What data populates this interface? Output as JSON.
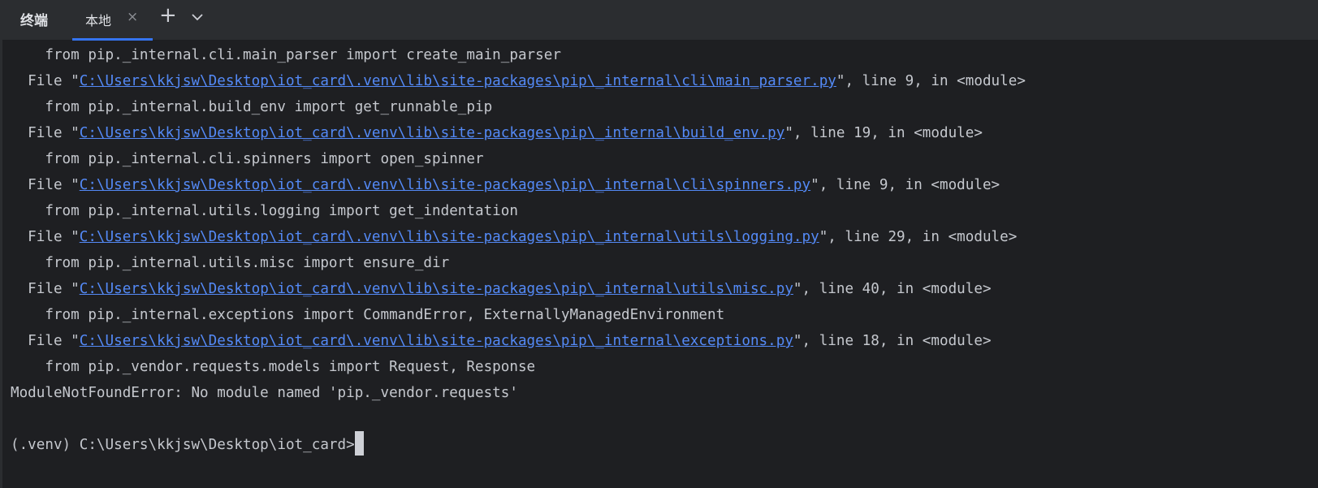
{
  "toolwindow": {
    "title": "终端",
    "tabs": [
      {
        "label": "本地",
        "close": "×"
      }
    ],
    "add_tab": "+",
    "colors": {
      "background": "#1e1f22",
      "header": "#2b2d30",
      "accent": "#3574f0",
      "link": "#548af7",
      "text": "#c5c8ce"
    }
  },
  "terminal": {
    "lines": [
      {
        "pre": "    from pip._internal.cli.main_parser import create_main_parser",
        "link": "",
        "post": ""
      },
      {
        "pre": "  File \"",
        "link": "C:\\Users\\kkjsw\\Desktop\\iot_card\\.venv\\lib\\site-packages\\pip\\_internal\\cli\\main_parser.py",
        "post": "\", line 9, in <module>"
      },
      {
        "pre": "    from pip._internal.build_env import get_runnable_pip",
        "link": "",
        "post": ""
      },
      {
        "pre": "  File \"",
        "link": "C:\\Users\\kkjsw\\Desktop\\iot_card\\.venv\\lib\\site-packages\\pip\\_internal\\build_env.py",
        "post": "\", line 19, in <module>"
      },
      {
        "pre": "    from pip._internal.cli.spinners import open_spinner",
        "link": "",
        "post": ""
      },
      {
        "pre": "  File \"",
        "link": "C:\\Users\\kkjsw\\Desktop\\iot_card\\.venv\\lib\\site-packages\\pip\\_internal\\cli\\spinners.py",
        "post": "\", line 9, in <module>"
      },
      {
        "pre": "    from pip._internal.utils.logging import get_indentation",
        "link": "",
        "post": ""
      },
      {
        "pre": "  File \"",
        "link": "C:\\Users\\kkjsw\\Desktop\\iot_card\\.venv\\lib\\site-packages\\pip\\_internal\\utils\\logging.py",
        "post": "\", line 29, in <module>"
      },
      {
        "pre": "    from pip._internal.utils.misc import ensure_dir",
        "link": "",
        "post": ""
      },
      {
        "pre": "  File \"",
        "link": "C:\\Users\\kkjsw\\Desktop\\iot_card\\.venv\\lib\\site-packages\\pip\\_internal\\utils\\misc.py",
        "post": "\", line 40, in <module>"
      },
      {
        "pre": "    from pip._internal.exceptions import CommandError, ExternallyManagedEnvironment",
        "link": "",
        "post": ""
      },
      {
        "pre": "  File \"",
        "link": "C:\\Users\\kkjsw\\Desktop\\iot_card\\.venv\\lib\\site-packages\\pip\\_internal\\exceptions.py",
        "post": "\", line 18, in <module>"
      },
      {
        "pre": "    from pip._vendor.requests.models import Request, Response",
        "link": "",
        "post": ""
      },
      {
        "pre": "ModuleNotFoundError: No module named 'pip._vendor.requests'",
        "link": "",
        "post": ""
      },
      {
        "pre": "",
        "link": "",
        "post": ""
      }
    ],
    "prompt": "(.venv) C:\\Users\\kkjsw\\Desktop\\iot_card>"
  }
}
